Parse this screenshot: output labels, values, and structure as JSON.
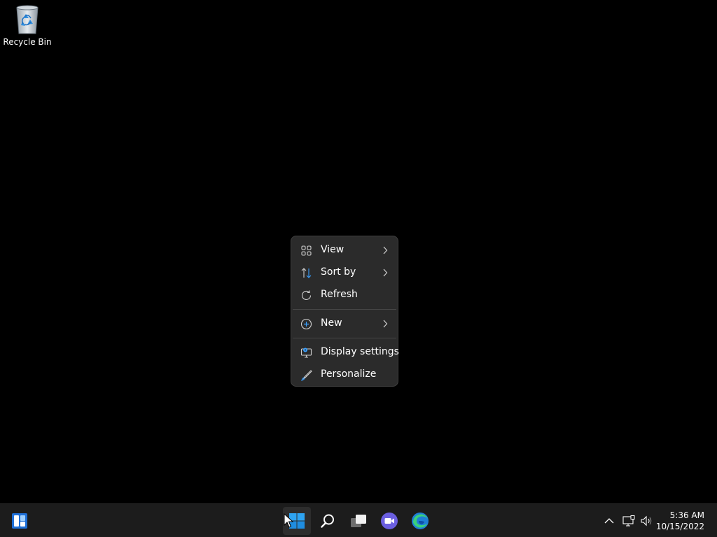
{
  "desktop": {
    "icons": [
      {
        "label": "Recycle Bin",
        "icon": "recycle-bin-icon"
      }
    ]
  },
  "context_menu": {
    "items": [
      {
        "label": "View",
        "icon": "grid-view-icon",
        "has_submenu": true
      },
      {
        "label": "Sort by",
        "icon": "sort-icon",
        "has_submenu": true
      },
      {
        "label": "Refresh",
        "icon": "refresh-icon",
        "has_submenu": false
      },
      {
        "label": "New",
        "icon": "new-plus-icon",
        "has_submenu": true
      },
      {
        "label": "Display settings",
        "icon": "display-settings-icon",
        "has_submenu": false
      },
      {
        "label": "Personalize",
        "icon": "brush-icon",
        "has_submenu": false
      }
    ]
  },
  "taskbar": {
    "apps": [
      {
        "name": "widgets",
        "icon": "widgets-icon"
      },
      {
        "name": "start",
        "icon": "windows-start-icon"
      },
      {
        "name": "search",
        "icon": "search-icon"
      },
      {
        "name": "task-view",
        "icon": "task-view-icon"
      },
      {
        "name": "teams-chat",
        "icon": "chat-video-icon"
      },
      {
        "name": "edge",
        "icon": "edge-browser-icon"
      }
    ],
    "tray": {
      "icons": [
        "chevron-up-icon",
        "network-icon",
        "volume-icon"
      ]
    },
    "clock": {
      "time": "5:36 AM",
      "date": "10/15/2022"
    }
  },
  "colors": {
    "desktop_bg": "#000000",
    "menu_bg": "#2b2b2b",
    "taskbar_bg": "#1c1c1c",
    "accent": "#0a84ff"
  }
}
